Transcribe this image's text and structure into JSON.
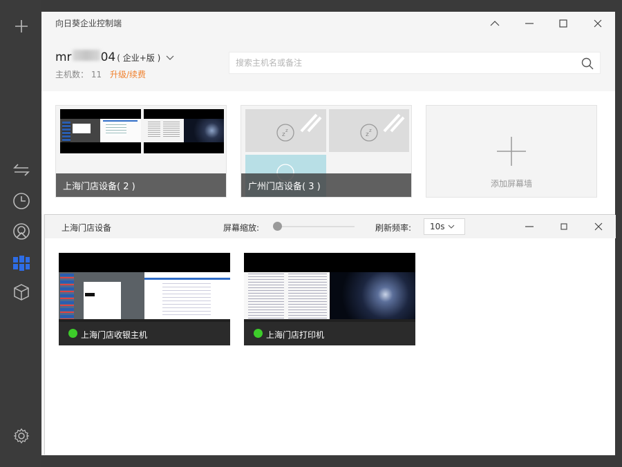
{
  "app": {
    "title": "向日葵企业控制端"
  },
  "sidebar": {
    "items": [
      {
        "icon": "plus-icon"
      },
      {
        "icon": "swap-icon"
      },
      {
        "icon": "clock-icon"
      },
      {
        "icon": "remote-icon"
      },
      {
        "icon": "screen-wall-icon",
        "active": true
      },
      {
        "icon": "box-icon"
      },
      {
        "icon": "gear-icon"
      }
    ],
    "active_color": "#2e6de6"
  },
  "account": {
    "name_prefix": "mr",
    "name_suffix": "04",
    "edition": "( 企业+版 )",
    "host_count_label": "主机数：",
    "host_count": "11",
    "upgrade_link": "升级/续费"
  },
  "search": {
    "placeholder": "搜索主机名或备注"
  },
  "screen_walls": [
    {
      "label": "上海门店设备( 2 )"
    },
    {
      "label": "广州门店设备( 3 )"
    }
  ],
  "add_wall": {
    "label": "添加屏幕墙"
  },
  "wall_window": {
    "title": "上海门店设备",
    "zoom_label": "屏幕缩放:",
    "zoom_value": 0,
    "refresh_label": "刷新频率:",
    "refresh_value": "10s",
    "hosts": [
      {
        "name": "上海门店收银主机",
        "status": "online"
      },
      {
        "name": "上海门店打印机",
        "status": "online"
      }
    ],
    "online_color": "#3dcc2a"
  },
  "accent": {
    "upgrade": "#f0812e"
  }
}
